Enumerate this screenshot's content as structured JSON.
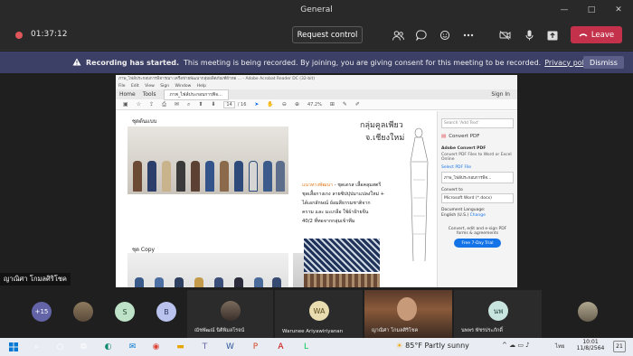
{
  "window": {
    "title": "General",
    "minimize": "—",
    "maximize": "□",
    "close": "✕"
  },
  "meeting": {
    "timer": "01:37:12",
    "request_control": "Request control",
    "leave": "Leave",
    "people_icon": "people-icon",
    "chat_icon": "chat-icon"
  },
  "banner": {
    "title": "Recording has started.",
    "text": "This meeting is being recorded. By joining, you are giving consent for this meeting to be recorded.",
    "link": "Privacy policy",
    "dismiss": "Dismiss"
  },
  "pdf": {
    "window_title": "ภาพ_ไฟล์ประกอบการพิจารณา เครือข่ายพัฒนากลุ่มผลิตภัณฑ์ผ้าทอ ... - Adobe Acrobat Reader DC (32-bit)",
    "menu": [
      "File",
      "Edit",
      "View",
      "Sign",
      "Window",
      "Help"
    ],
    "tab_home": "Home",
    "tab_tools": "Tools",
    "tab_doc": "ภาพ_ไฟล์ประกอบการพิจ...",
    "sign_in": "Sign In",
    "page_current": "14",
    "page_total": "/ 16",
    "zoom": "47.2%",
    "heading1": "ชุดต้นแบบ",
    "heading2": "ชุด Copy",
    "group_title_1": "กลุ่มคูลเพียว",
    "group_title_2": "จ.เชียงใหม่",
    "desc_orange": "แนวทางพัฒนา",
    "desc_lines": [
      "- ชุดเดรส  เสื้อคลุมสตรี",
      "ชุดเสื้อกางเกง  ลายซิปปุปมาแปลงใหม่ +",
      "ได้เอกลักษณ์  ย้อมสีธรรมชาติจาก",
      "คราม และ มะเกลือ  ใช้ผ้าฝ้ายจีน",
      "40/2 ที่ทอจากกลุ่มเข้าทีม"
    ],
    "side": {
      "search": "Search 'Add Text'",
      "convert": "Convert PDF",
      "adobe_convert": "Adobe Convert PDF",
      "convert_desc": "Convert PDF Files to Word or Excel Online",
      "select_file": "Select PDF File",
      "file_name": "ภาพ_ไฟล์ประกอบการพิจ...",
      "convert_to": "Convert to",
      "format": "Microsoft Word (*.docx)",
      "doc_lang": "Document Language:",
      "lang": "English (U.S.)",
      "change": "Change",
      "promo": "Convert, edit and e-sign PDF forms & agreements",
      "trial": "Free 7-Day Trial"
    }
  },
  "presenter_name": "ญาณิศา โกมลศิริโชค",
  "participants": {
    "more_count": "+15",
    "initial_s": "S",
    "initial_b": "B",
    "initial_wa": "WA",
    "initial_np": "นพ",
    "tile1": "ณัชพัฒณ์ นิติพิมลโรจน์",
    "tile2": "Warunee Ariyawiriyanan",
    "tile3": "ญาณิศา โกมลศิริโชค",
    "tile4": "นพพร พัชรประภักดิ์"
  },
  "taskbar": {
    "weather": "85°F  Partly sunny",
    "time": "10:01",
    "date": "11/8/2564",
    "lang": "ไทย",
    "notif": "21"
  },
  "colors": {
    "leave": "#c4314b",
    "banner": "#3c3f66",
    "trial": "#1473e6"
  }
}
